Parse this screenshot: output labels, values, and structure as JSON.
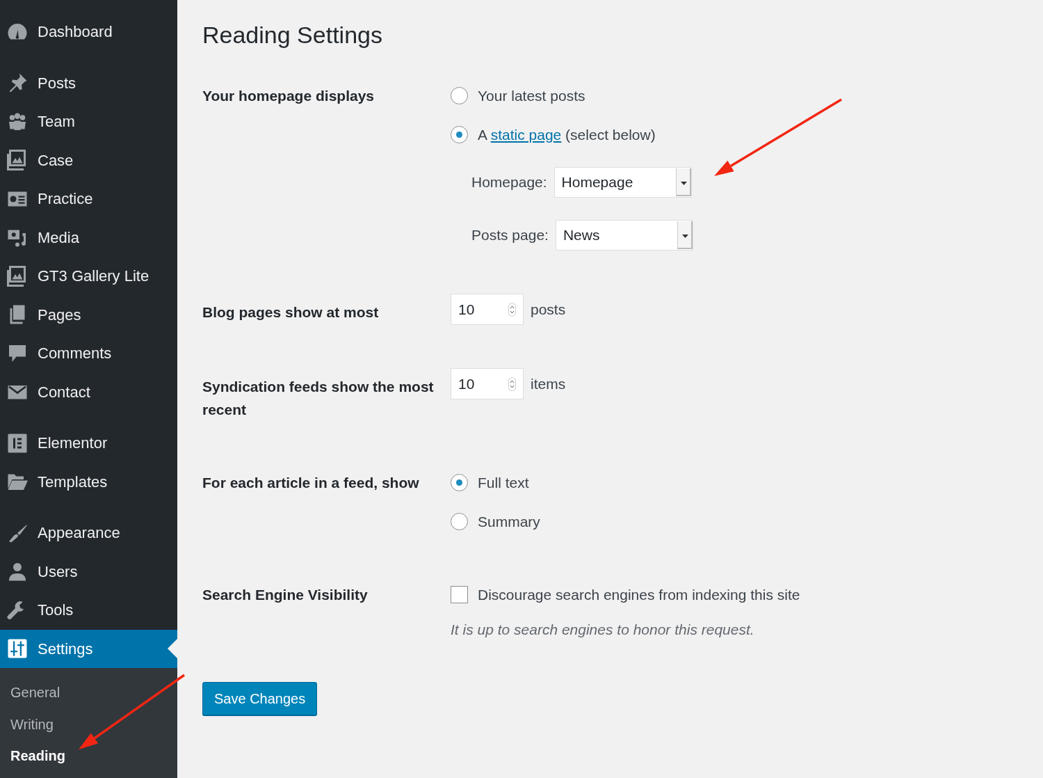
{
  "sidebar": {
    "menu_groups": [
      [
        {
          "label": "Dashboard",
          "selected": false
        }
      ],
      [
        {
          "label": "Posts",
          "selected": false
        },
        {
          "label": "Team",
          "selected": false
        },
        {
          "label": "Case",
          "selected": false
        },
        {
          "label": "Practice",
          "selected": false
        },
        {
          "label": "Media",
          "selected": false
        },
        {
          "label": "GT3 Gallery Lite",
          "selected": false
        },
        {
          "label": "Pages",
          "selected": false
        },
        {
          "label": "Comments",
          "selected": false
        },
        {
          "label": "Contact",
          "selected": false
        }
      ],
      [
        {
          "label": "Elementor",
          "selected": false
        },
        {
          "label": "Templates",
          "selected": false
        }
      ],
      [
        {
          "label": "Appearance",
          "selected": false
        },
        {
          "label": "Users",
          "selected": false
        },
        {
          "label": "Tools",
          "selected": false
        },
        {
          "label": "Settings",
          "selected": true
        }
      ]
    ],
    "submenu": [
      {
        "label": "General",
        "selected": false
      },
      {
        "label": "Writing",
        "selected": false
      },
      {
        "label": "Reading",
        "selected": true
      }
    ]
  },
  "page": {
    "title": "Reading Settings"
  },
  "settings": [
    {
      "kind": "radio_group",
      "label": "Your homepage displays",
      "options": [
        {
          "text": "Your latest posts",
          "selected": false
        },
        {
          "text": "A",
          "link": "static page",
          "text_after": "(select below)",
          "selected": true
        }
      ],
      "selects": [
        {
          "label": "Homepage:",
          "value": "Homepage"
        },
        {
          "label": "Posts page:",
          "value": "News"
        }
      ]
    },
    {
      "kind": "number",
      "label": "Blog pages show at most",
      "value": "10",
      "unit": "posts"
    },
    {
      "kind": "number",
      "label": "Syndication feeds show the most recent",
      "value": "10",
      "unit": "items"
    },
    {
      "kind": "radio_group",
      "label": "For each article in a feed, show",
      "options": [
        {
          "text": "Full text",
          "selected": true
        },
        {
          "text": "Summary",
          "selected": false
        }
      ]
    },
    {
      "kind": "checkbox",
      "label": "Search Engine Visibility",
      "text": "Discourage search engines from indexing this site",
      "checked": false,
      "description": "It is up to search engines to honor this request."
    }
  ],
  "save_button": "Save Changes"
}
